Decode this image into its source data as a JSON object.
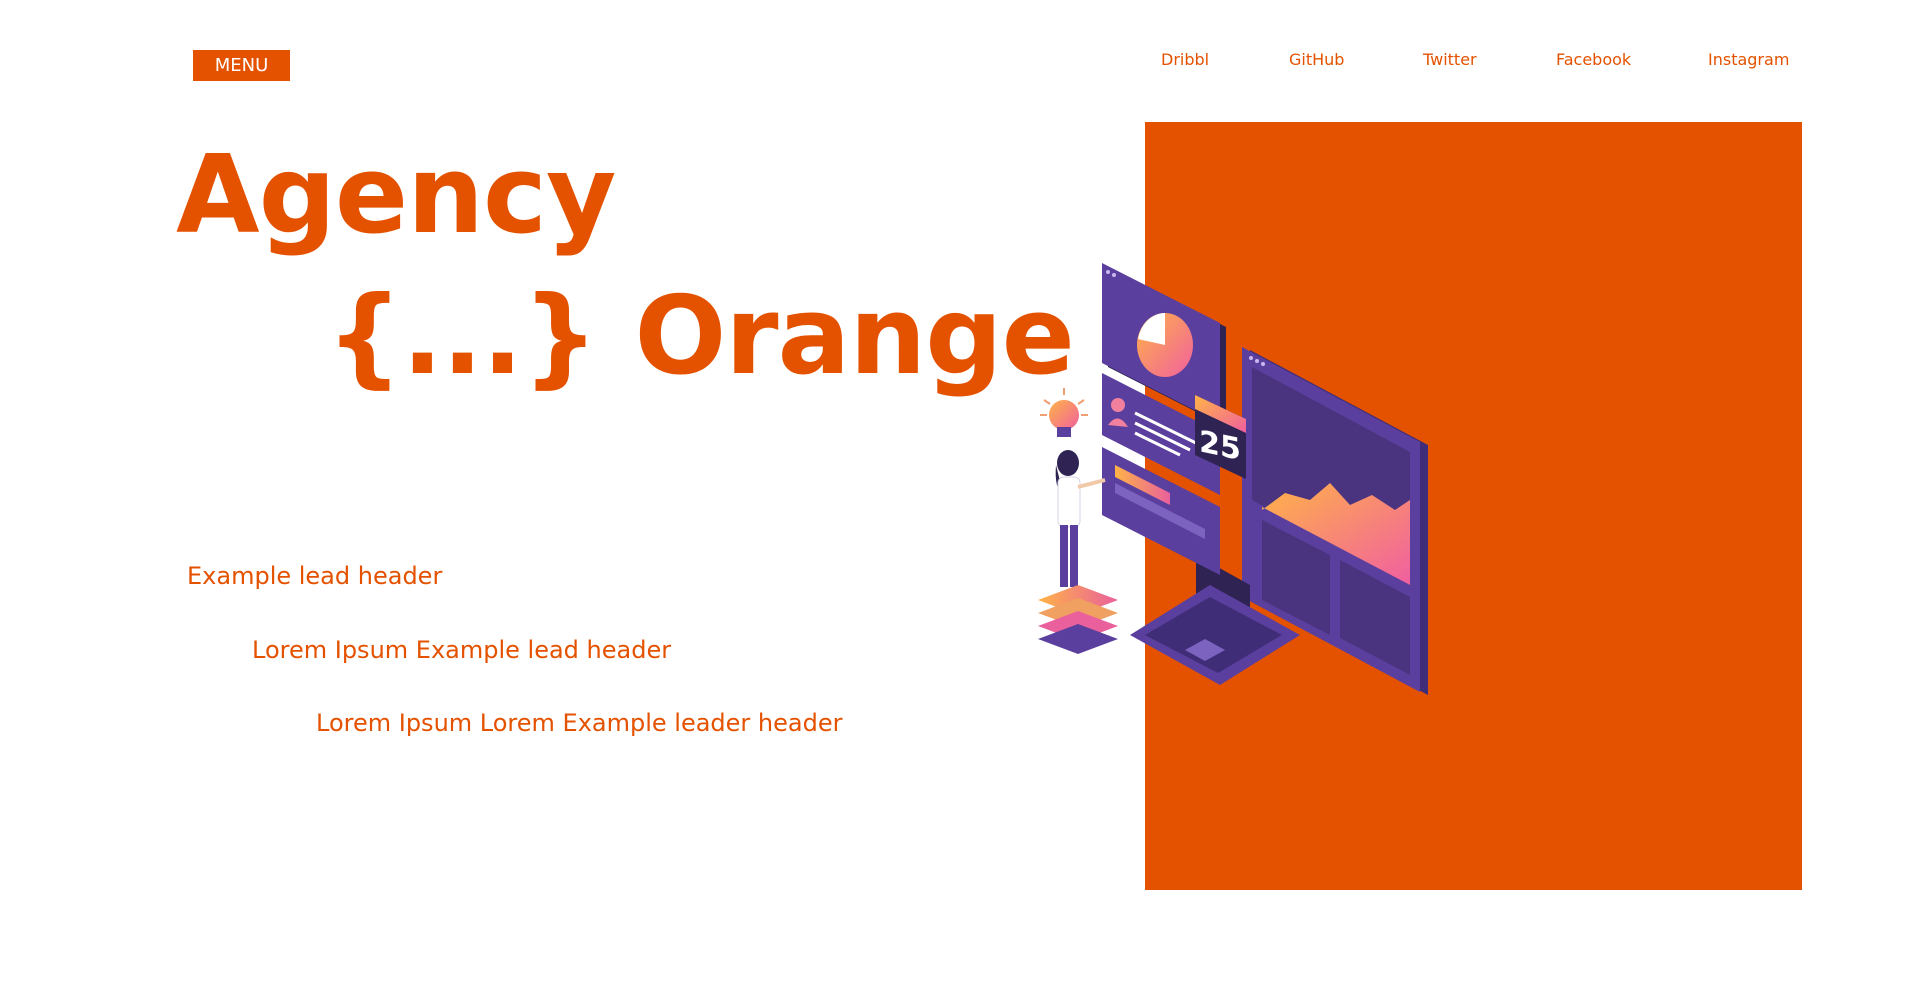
{
  "header": {
    "menu_label": "MENU"
  },
  "social_links": [
    {
      "label": "Dribbl"
    },
    {
      "label": "GitHub"
    },
    {
      "label": "Twitter"
    },
    {
      "label": "Facebook"
    },
    {
      "label": "Instagram"
    }
  ],
  "hero": {
    "title_line1": "Agency",
    "title_line2": "{...} Orange"
  },
  "leads": [
    "Example lead header",
    "Lorem Ipsum Example lead header",
    "Lorem Ipsum Lorem Example leader header"
  ],
  "illustration": {
    "calendar_number": "25",
    "icons": [
      "lightbulb-icon",
      "pie-chart-icon",
      "user-icon",
      "area-chart-icon",
      "laptop-icon"
    ]
  },
  "colors": {
    "accent": "#e45200",
    "background": "#ffffff",
    "illustration_purple": "#5b3f9e",
    "illustration_dark": "#2e2352"
  }
}
